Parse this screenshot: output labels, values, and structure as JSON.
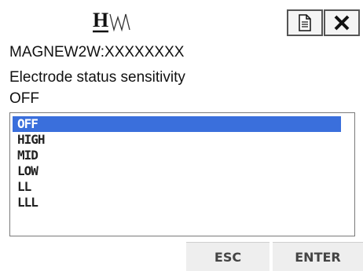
{
  "header": {
    "logo_text": "H",
    "doc_icon": "document-icon",
    "close_icon": "close-icon"
  },
  "device_id": "MAGNEW2W:XXXXXXXX",
  "parameter_name": "Electrode status sensitivity",
  "current_value": "OFF",
  "options": [
    {
      "label": "OFF",
      "selected": true
    },
    {
      "label": "HIGH",
      "selected": false
    },
    {
      "label": "MID",
      "selected": false
    },
    {
      "label": "LOW",
      "selected": false
    },
    {
      "label": "LL",
      "selected": false
    },
    {
      "label": "LLL",
      "selected": false
    }
  ],
  "buttons": {
    "esc": "ESC",
    "enter": "ENTER"
  },
  "colors": {
    "selection": "#3a6fdc"
  }
}
